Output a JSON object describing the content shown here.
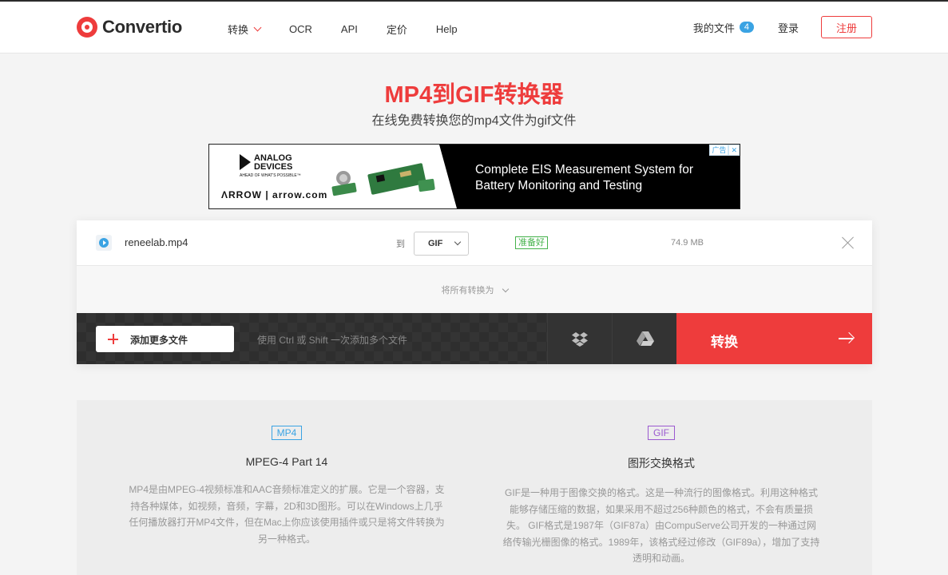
{
  "brand": {
    "name": "Convertio",
    "accent": "#ee3c3c"
  },
  "nav": {
    "items": [
      {
        "label": "转换",
        "dropdown": true
      },
      {
        "label": "OCR"
      },
      {
        "label": "API"
      },
      {
        "label": "定价"
      },
      {
        "label": "Help"
      }
    ],
    "my_files": "我的文件",
    "my_files_count": "4",
    "login": "登录",
    "register": "注册"
  },
  "hero": {
    "title": "MP4到GIF转换器",
    "subtitle": "在线免费转换您的mp4文件为gif文件"
  },
  "ad": {
    "brand_line1": "ANALOG",
    "brand_line2": "DEVICES",
    "brand_tagline": "AHEAD OF WHAT'S POSSIBLE™",
    "partner": "ΛRRΟW | arrow.com",
    "headline": "Complete EIS Measurement System for\nBattery Monitoring and Testing",
    "label": "广告",
    "close": "✕"
  },
  "file": {
    "name": "reneelab.mp4",
    "to_label": "到",
    "format": "GIF",
    "status": "准备好",
    "size": "74.9 MB"
  },
  "convert_all": "将所有转换为",
  "actions": {
    "add_more": "添加更多文件",
    "hint": "使用 Ctrl 或 Shift 一次添加多个文件",
    "convert": "转换"
  },
  "info": {
    "left": {
      "tag": "MP4",
      "title": "MPEG-4 Part 14",
      "desc": "MP4是由MPEG-4视频标准和AAC音频标准定义的扩展。它是一个容器，支持各种媒体，如视频，音频，字幕，2D和3D图形。可以在Windows上几乎任何播放器打开MP4文件，但在Mac上你应该使用插件或只是将文件转换为另一种格式。"
    },
    "right": {
      "tag": "GIF",
      "title": "图形交换格式",
      "desc": "GIF是一种用于图像交换的格式。这是一种流行的图像格式。利用这种格式能够存储压缩的数据，如果采用不超过256种颜色的格式，不会有质量损失。 GIF格式是1987年（GIF87a）由CompuServe公司开发的一种通过网络传输光栅图像的格式。1989年，该格式经过修改（GIF89a），增加了支持透明和动画。"
    }
  }
}
